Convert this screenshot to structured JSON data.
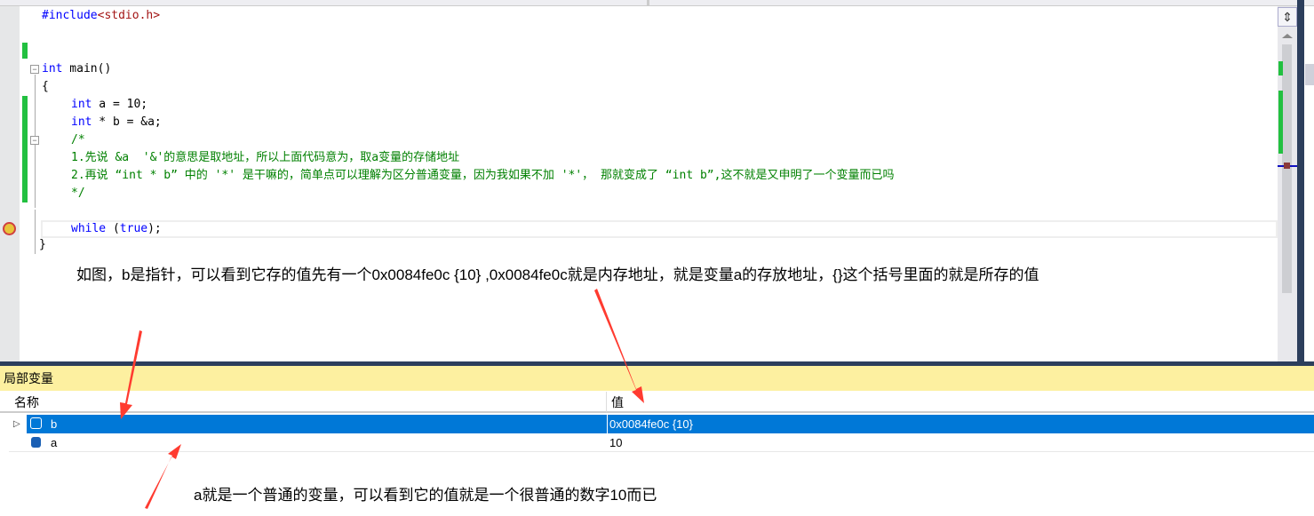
{
  "editor": {
    "include_directive": "#include",
    "include_file": "<stdio.h>",
    "lines": {
      "main_kw": "int",
      "main_rest": " main()",
      "open": "{",
      "a_kw": "int",
      "a_rest": " a = 10;",
      "b_kw": "int",
      "b_rest": " * b = &a;",
      "c_open": "/*",
      "c1": "1.先说 &a  '&'的意思是取地址，所以上面代码意为，取a变量的存储地址",
      "c2": "2.再说 “int * b” 中的 '*' 是干嘛的，简单点可以理解为区分普通变量，因为我如果不加 '*'， 那就变成了 “int b”,这不就是又申明了一个变量而已吗",
      "c_close": "*/",
      "while_kw": "while",
      "while_mid": " (",
      "true_kw": "true",
      "while_end": ");",
      "close": "}"
    }
  },
  "annotations": {
    "top": "如图，b是指针，可以看到它存的值先有一个0x0084fe0c {10} ,0x0084fe0c就是内存地址，就是变量a的存放地址，{}这个括号里面的就是所存的值",
    "bottom": "a就是一个普通的变量，可以看到它的值就是一个很普通的数字10而已"
  },
  "locals": {
    "title": "局部变量",
    "columns": {
      "name": "名称",
      "value": "值"
    },
    "rows": [
      {
        "name": "b",
        "value": "0x0084fe0c {10}",
        "selected": true,
        "expandable": true
      },
      {
        "name": "a",
        "value": "10",
        "selected": false,
        "expandable": false
      }
    ]
  },
  "colors": {
    "selection": "#0078d7",
    "arrow": "#ff3b30",
    "comment": "#008000",
    "keyword": "#0000ff"
  }
}
